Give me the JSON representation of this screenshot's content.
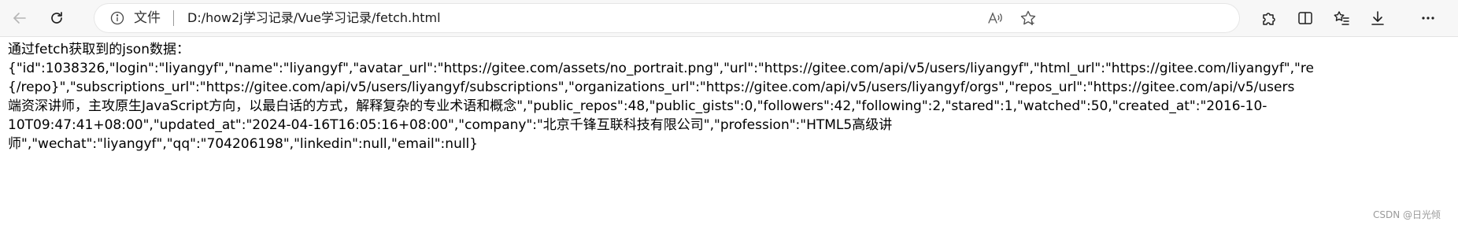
{
  "browser": {
    "address_file_label": "文件",
    "address_url": "D:/how2j学习记录/Vue学习记录/fetch.html"
  },
  "page": {
    "heading": "通过fetch获取到的json数据：",
    "lines": [
      "{\"id\":1038326,\"login\":\"liyangyf\",\"name\":\"liyangyf\",\"avatar_url\":\"https://gitee.com/assets/no_portrait.png\",\"url\":\"https://gitee.com/api/v5/users/liyangyf\",\"html_url\":\"https://gitee.com/liyangyf\",\"re",
      "{/repo}\",\"subscriptions_url\":\"https://gitee.com/api/v5/users/liyangyf/subscriptions\",\"organizations_url\":\"https://gitee.com/api/v5/users/liyangyf/orgs\",\"repos_url\":\"https://gitee.com/api/v5/users",
      "端资深讲师，主攻原生JavaScript方向，以最白话的方式，解释复杂的专业术语和概念\",\"public_repos\":48,\"public_gists\":0,\"followers\":42,\"following\":2,\"stared\":1,\"watched\":50,\"created_at\":\"2016-10-",
      "10T09:47:41+08:00\",\"updated_at\":\"2024-04-16T16:05:16+08:00\",\"company\":\"北京千锋互联科技有限公司\",\"profession\":\"HTML5高级讲",
      "师\",\"wechat\":\"liyangyf\",\"qq\":\"704206198\",\"linkedin\":null,\"email\":null}"
    ]
  },
  "watermark": "CSDN @日光倾",
  "icons": {
    "back": "back-arrow-icon",
    "reload": "reload-icon",
    "info": "info-icon",
    "read_aloud": "read-aloud-icon",
    "favorite": "favorite-star-icon",
    "extensions": "extensions-icon",
    "split_screen": "split-screen-icon",
    "favorites": "favorites-icon",
    "downloads": "downloads-icon",
    "more": "more-icon"
  }
}
